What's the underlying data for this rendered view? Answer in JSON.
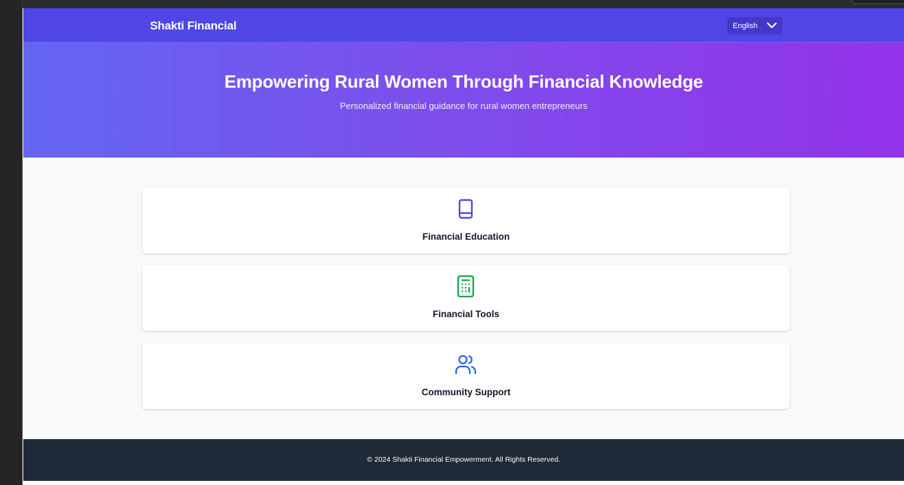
{
  "navbar": {
    "brand": "Shakti Financial",
    "language_select": {
      "value": "English"
    }
  },
  "hero": {
    "title": "Empowering Rural Women Through Financial Knowledge",
    "subtitle": "Personalized financial guidance for rural women entrepreneurs"
  },
  "cards": [
    {
      "title": "Financial Education",
      "icon": "book-icon",
      "color": "#4f46e5"
    },
    {
      "title": "Financial Tools",
      "icon": "calculator-icon",
      "color": "#16a34a"
    },
    {
      "title": "Community Support",
      "icon": "users-icon",
      "color": "#2563eb"
    }
  ],
  "footer": {
    "text": "© 2024 Shakti Financial Empowerment. All Rights Reserved."
  },
  "colors": {
    "navbar": "#4f46e5",
    "hero_start": "#6366f1",
    "hero_end": "#9333ea",
    "footer": "#1f2937",
    "background": "#f8f9fb"
  }
}
